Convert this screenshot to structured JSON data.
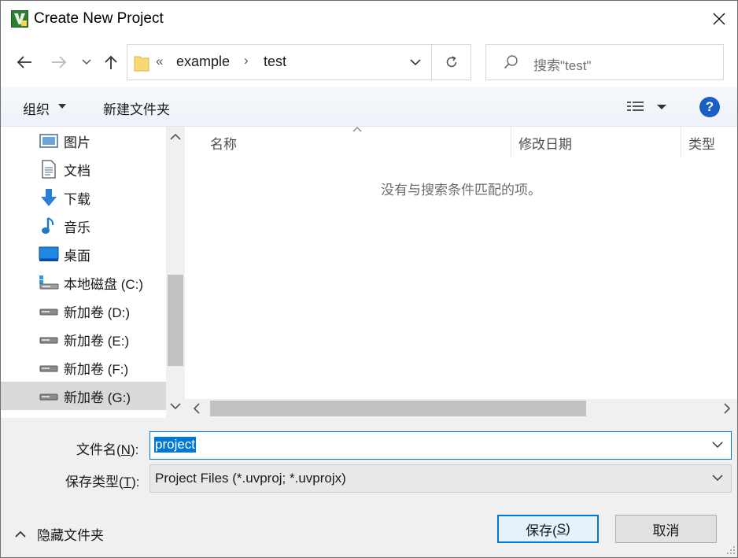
{
  "window": {
    "title": "Create New Project"
  },
  "address": {
    "overflow_chevron": "«",
    "segments": [
      "example",
      "test"
    ],
    "separator": "›"
  },
  "search": {
    "placeholder": "搜索\"test\""
  },
  "toolbar": {
    "organize_label": "组织",
    "new_folder_label": "新建文件夹",
    "help_label": "?"
  },
  "nav": {
    "items": [
      {
        "label": "图片",
        "icon": "pictures-icon"
      },
      {
        "label": "文档",
        "icon": "documents-icon"
      },
      {
        "label": "下载",
        "icon": "downloads-icon"
      },
      {
        "label": "音乐",
        "icon": "music-icon"
      },
      {
        "label": "桌面",
        "icon": "desktop-icon"
      },
      {
        "label": "本地磁盘 (C:)",
        "icon": "system-drive-icon"
      },
      {
        "label": "新加卷 (D:)",
        "icon": "drive-icon"
      },
      {
        "label": "新加卷 (E:)",
        "icon": "drive-icon"
      },
      {
        "label": "新加卷 (F:)",
        "icon": "drive-icon"
      },
      {
        "label": "新加卷 (G:)",
        "icon": "drive-icon",
        "selected": true
      }
    ]
  },
  "filelist": {
    "columns": [
      "名称",
      "修改日期",
      "类型"
    ],
    "empty_message": "没有与搜索条件匹配的项。"
  },
  "form": {
    "filename_label_text": "文件名(",
    "filename_label_key": "N",
    "filename_label_end": "):",
    "filename_value": "project",
    "filetype_label_text": "保存类型(",
    "filetype_label_key": "T",
    "filetype_label_end": "):",
    "filetype_value": "Project Files (*.uvproj; *.uvprojx)"
  },
  "footer": {
    "hide_folders_label": "隐藏文件夹",
    "save_text": "保存(",
    "save_key": "S",
    "save_end": ")",
    "cancel_label": "取消"
  },
  "colors": {
    "accent": "#0078d7",
    "help": "#1c5fc4",
    "selected_row": "#d9d9d9"
  }
}
